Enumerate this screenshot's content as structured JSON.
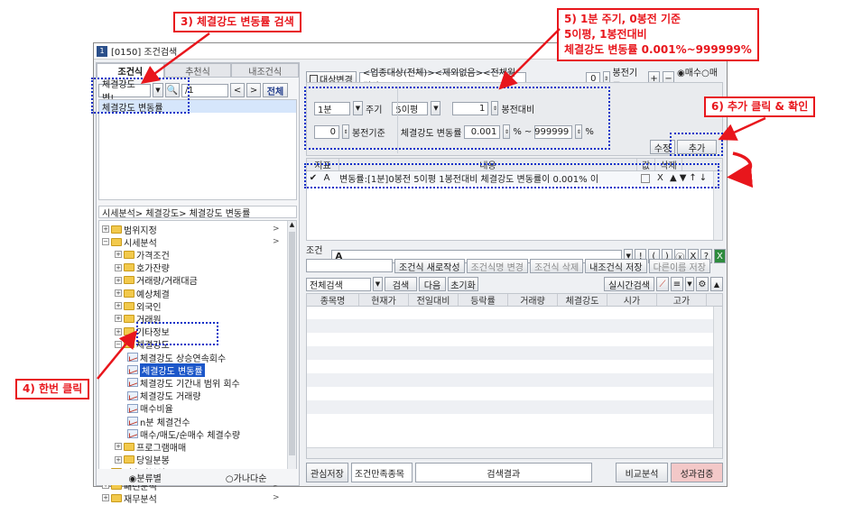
{
  "window": {
    "title": "[0150] 조건검색",
    "icon": "1"
  },
  "left": {
    "tabs": [
      "조건식",
      "추천식",
      "내조건식"
    ],
    "search_value": "체결강도 변!",
    "search_page": "/1",
    "prev": "<",
    "next": ">",
    "all_btn": "전체",
    "result_item": "체결강도 변동률",
    "breadcrumb": "시세분석> 체결강도> 체결강도 변동률",
    "tree": [
      {
        "label": "범위지정",
        "level": 0,
        "pm": "+",
        "arrow": ">"
      },
      {
        "label": "시세분석",
        "level": 0,
        "pm": "−",
        "arrow": ">"
      },
      {
        "label": "가격조건",
        "level": 1,
        "pm": "+"
      },
      {
        "label": "호가잔량",
        "level": 1,
        "pm": "+"
      },
      {
        "label": "거래량/거래대금",
        "level": 1,
        "pm": "+"
      },
      {
        "label": "예상체결",
        "level": 1,
        "pm": "+"
      },
      {
        "label": "외국인",
        "level": 1,
        "pm": "+"
      },
      {
        "label": "거래원",
        "level": 1,
        "pm": "+"
      },
      {
        "label": "기타정보",
        "level": 1,
        "pm": "+"
      },
      {
        "label": "체결강도",
        "level": 1,
        "pm": "−"
      },
      {
        "label": "체결강도 상승연속회수",
        "level": 2,
        "leaf": true
      },
      {
        "label": "체결강도 변동률",
        "level": 2,
        "leaf": true,
        "selected": true
      },
      {
        "label": "체결강도 기간내 범위 회수",
        "level": 2,
        "leaf": true
      },
      {
        "label": "체결강도 거래량",
        "level": 2,
        "leaf": true
      },
      {
        "label": "매수비율",
        "level": 2,
        "leaf": true
      },
      {
        "label": "n분 체결건수",
        "level": 2,
        "leaf": true
      },
      {
        "label": "매수/매도/순매수 체결수량",
        "level": 2,
        "leaf": true
      },
      {
        "label": "프로그램매매",
        "level": 1,
        "pm": "+"
      },
      {
        "label": "당일분봉",
        "level": 1,
        "pm": "+"
      },
      {
        "label": "기술적분석",
        "level": 0,
        "pm": "+",
        "arrow": ">"
      },
      {
        "label": "패턴분석",
        "level": 0,
        "pm": "+",
        "arrow": ">"
      },
      {
        "label": "재무분석",
        "level": 0,
        "pm": "+",
        "arrow": ">"
      }
    ],
    "radio1": "◉분류별",
    "radio2": "○가나다순"
  },
  "right": {
    "target_label": "대상변경",
    "target_text": "<업종대상(전체)><제외없음><전체월결산>",
    "base_num": "0",
    "base_text": "봉전기준",
    "plus": "+",
    "minus": "−",
    "buy_sell": "◉매수○매도",
    "cycle": "1분",
    "cycle_label": "주기",
    "avg": "5이평",
    "prev_n": "1",
    "prev_label": "봉전대비",
    "base_n": "0",
    "base_label": "봉전기준",
    "rate_label": "체결강도 변동률",
    "min": "0.001",
    "pct": "%",
    "tilde": "~",
    "max": "999999",
    "edit_btn": "수정",
    "add_btn": "추가",
    "cond_headers": [
      "지표",
      "내용",
      "값",
      "삭제"
    ],
    "cond_row": {
      "check": "✔",
      "letter": "A",
      "text": "변동률:[1분]0봉전 5이평 1봉전대비 체결강도 변동률이 0.001% 이",
      "x": "X",
      "ops": "▲▼↑↓"
    },
    "expr_label": "조건식",
    "expr_value": "A",
    "expr_btns": [
      "!",
      "(",
      ")",
      "ⓧ",
      "X",
      "?"
    ],
    "new_btn": "조건식 새로작성",
    "rename_btn": "조건식명 변경",
    "delete_btn": "조건식 삭제",
    "save_btn": "내조건식 저장",
    "saveas_btn": "다른이름 저장",
    "search_mode": "전체검색",
    "search_btn": "검색",
    "next_btn": "다음",
    "reset_btn": "초기화",
    "realtime_btn": "실시간검색",
    "grid_headers": [
      "종목명",
      "현재가",
      "전일대비",
      "등락률",
      "거래량",
      "체결강도",
      "시가",
      "고가"
    ],
    "bottom": {
      "watch_btn": "관심저장",
      "count_label": "조건만족종목",
      "result_label": "검색결과",
      "compare_btn": "비교분석",
      "verify_btn": "성과검증"
    }
  },
  "callouts": {
    "c3": "3) 체결강도 변동률 검색",
    "c5": [
      "5) 1분 주기, 0봉전 기준",
      "5이평, 1봉전대비",
      "체결강도 변동률 0.001%~999999%"
    ],
    "c6": "6) 추가 클릭 & 확인",
    "c4": "4) 한번 클릭"
  },
  "colors": {
    "callout_red": "#e8161c",
    "dotted_blue": "#0a2fc8",
    "selected_bg": "#1c57c9"
  }
}
